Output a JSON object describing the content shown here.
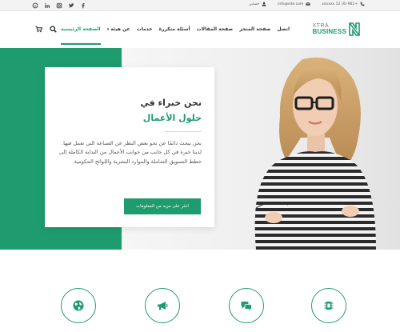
{
  "topbar": {
    "phone": "+961 (0) 12 xxxxxx",
    "email": "info@site.com",
    "account": "حسابي",
    "social": [
      "skype-icon",
      "linkedin-icon",
      "instagram-icon",
      "twitter-icon",
      "facebook-icon"
    ]
  },
  "logo": {
    "line1": "XTRA",
    "line2": "BUSINESS"
  },
  "menu": {
    "items": [
      {
        "label": "الصفحة الرئيسية",
        "active": true
      },
      {
        "label": "عن هيئة",
        "dropdown": true
      },
      {
        "label": "خدمات"
      },
      {
        "label": "أسئلة متكررة"
      },
      {
        "label": "صفحة المقالات"
      },
      {
        "label": "صفحة المتجر"
      },
      {
        "label": "اتصل"
      }
    ]
  },
  "hero": {
    "title_line1": "نحن خبراء في",
    "title_line2": "حلول الأعمال",
    "paragraph": "نحن نبحث دائمًا عن نحو بعض النظر عن الصناعة التي تعمل فيها. لدينا خبرة في كل جانب من جوانب الأعمال من البداية الكاملة إلى خطط التسويق الشاملة والموارد البشرية واللوائح الحكومية.",
    "button_label": "اعثر على مزيد من المعلومات"
  },
  "features": {
    "icons": [
      "globe-icon",
      "megaphone-icon",
      "chat-icon",
      "chip-icon"
    ]
  },
  "colors": {
    "accent": "#1e9b6f",
    "topbar": "#f3f3f3"
  }
}
